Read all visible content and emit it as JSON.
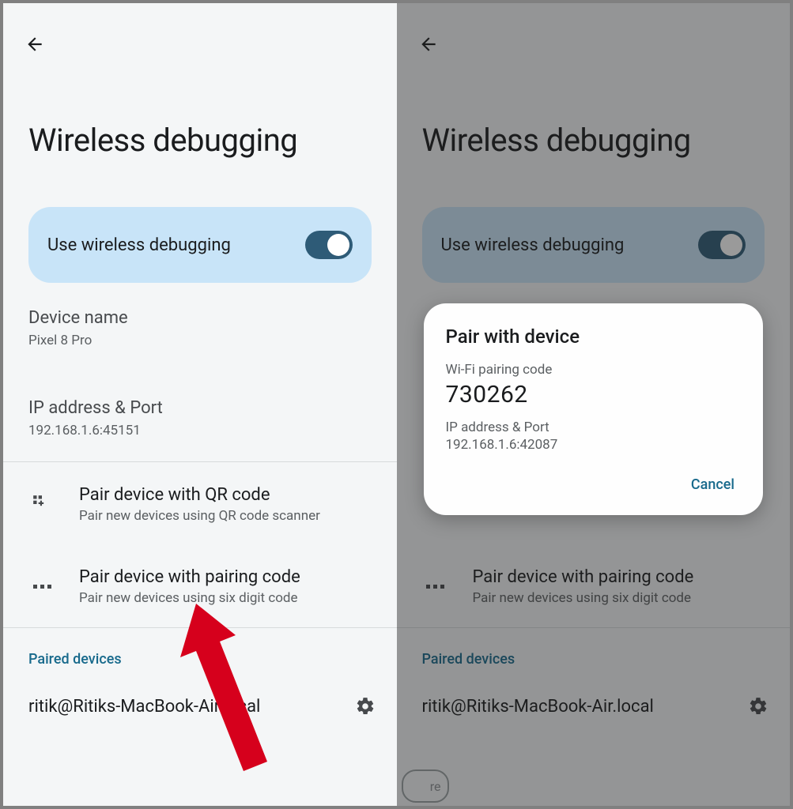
{
  "left": {
    "title": "Wireless debugging",
    "toggle_label": "Use wireless debugging",
    "device_name_label": "Device name",
    "device_name_value": "Pixel 8 Pro",
    "ip_port_label": "IP address & Port",
    "ip_port_value": "192.168.1.6:45151",
    "pair_qr_title": "Pair device with QR code",
    "pair_qr_sub": "Pair new devices using QR code scanner",
    "pair_code_title": "Pair device with pairing code",
    "pair_code_sub": "Pair new devices using six digit code",
    "paired_devices_label": "Paired devices",
    "paired_device_name": "ritik@Ritiks-MacBook-Air.local"
  },
  "right": {
    "title": "Wireless debugging",
    "toggle_label": "Use wireless debugging",
    "pair_code_title": "Pair device with pairing code",
    "pair_code_sub": "Pair new devices using six digit code",
    "paired_devices_label": "Paired devices",
    "paired_device_name": "ritik@Ritiks-MacBook-Air.local",
    "ghost_btn": "re",
    "dialog": {
      "title": "Pair with device",
      "sub": "Wi-Fi pairing code",
      "code": "730262",
      "ip_label": "IP address & Port",
      "ip_value": "192.168.1.6:42087",
      "cancel": "Cancel"
    }
  }
}
